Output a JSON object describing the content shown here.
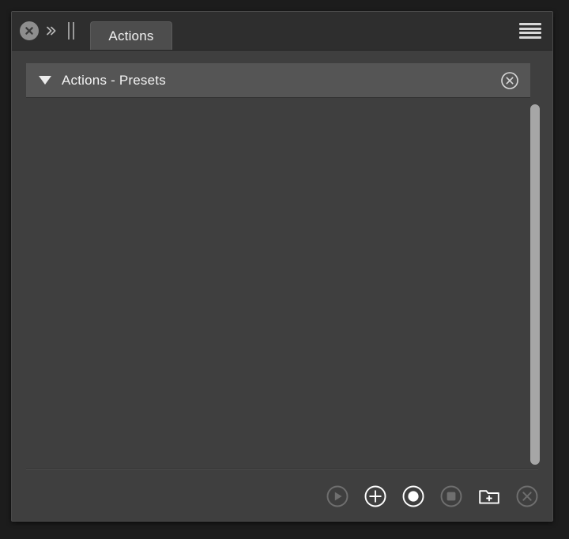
{
  "window": {
    "title": "Actions"
  },
  "titlebar": {
    "close_icon": "close-circle-icon",
    "collapse_icon": "double-chevron-right-icon",
    "grip_icon": "drag-grip-icon",
    "tab_label": "Actions",
    "menu_icon": "hamburger-menu-icon"
  },
  "list": {
    "groups": [
      {
        "label": "Actions - Presets",
        "expanded": true,
        "disclosure_icon": "triangle-down-icon",
        "close_icon": "close-circle-outline-icon"
      }
    ],
    "items": []
  },
  "scrollbar": {
    "name": "vertical-scrollbar",
    "thumb_name": "vertical-scrollbar-thumb"
  },
  "footer": {
    "buttons": [
      {
        "name": "play-button",
        "icon": "play-circle-icon",
        "label": "Play",
        "enabled": false
      },
      {
        "name": "add-button",
        "icon": "plus-circle-icon",
        "label": "Add",
        "enabled": true
      },
      {
        "name": "record-button",
        "icon": "record-circle-icon",
        "label": "Record",
        "enabled": true
      },
      {
        "name": "stop-button",
        "icon": "stop-circle-icon",
        "label": "Stop",
        "enabled": false
      },
      {
        "name": "new-group-button",
        "icon": "folder-plus-icon",
        "label": "New Group",
        "enabled": true
      },
      {
        "name": "delete-button",
        "icon": "close-circle-outline-icon",
        "label": "Delete",
        "enabled": false
      }
    ]
  },
  "colors": {
    "app_background": "#1c1c1c",
    "panel_background": "#3f3f3f",
    "titlebar_background": "#2e2e2e",
    "tab_background": "#4d4d4d",
    "group_row_background": "#555555",
    "text_primary": "#f2f2f2",
    "icon_active": "#ffffff",
    "icon_disabled": "#6f6f6f",
    "scrollbar_thumb": "#a6a6a6"
  }
}
